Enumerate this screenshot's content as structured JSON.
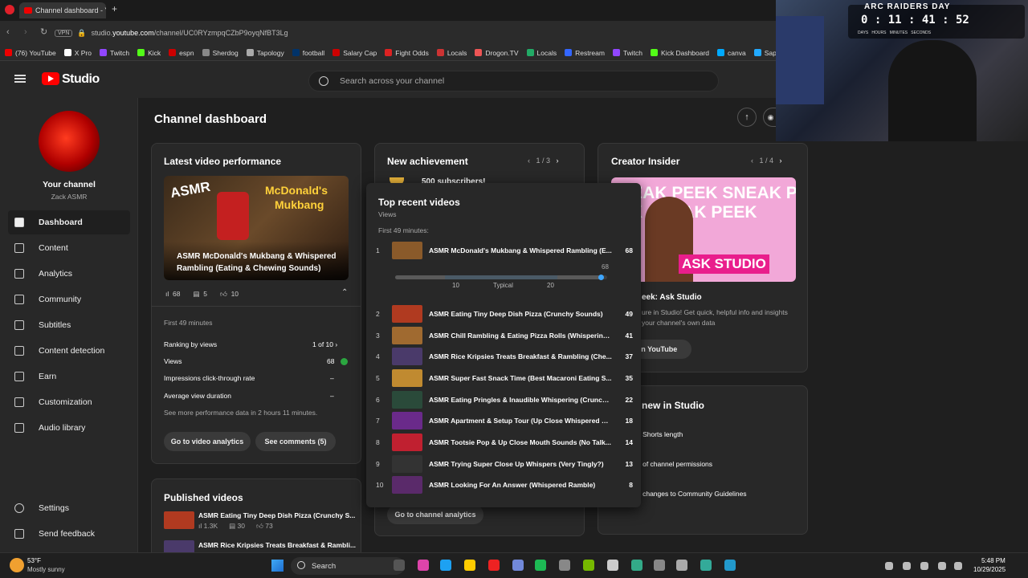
{
  "browser": {
    "tab_title": "Channel dashboard - You",
    "url_prefix": "studio.",
    "url_domain": "youtube.com",
    "url_path": "/channel/UC0RYzmpqCZbP9oyqNfBT3Lg",
    "vpn_label": "VPN",
    "bookmarks": [
      "(76) YouTube",
      "X Pro",
      "Twitch",
      "Kick",
      "espn",
      "Sherdog",
      "Tapology",
      "football",
      "Salary Cap",
      "Fight Odds",
      "Locals",
      "Drogon.TV",
      "Locals",
      "Restream",
      "Twitch",
      "Kick Dashboard",
      "canva",
      "Sapphire | Dashboard"
    ]
  },
  "header": {
    "logo_text": "Studio",
    "search_placeholder": "Search across your channel"
  },
  "sidebar": {
    "channel_label": "Your channel",
    "channel_name": "Zack ASMR",
    "items": [
      {
        "label": "Dashboard",
        "icon": "dashboard-icon"
      },
      {
        "label": "Content",
        "icon": "content-icon"
      },
      {
        "label": "Analytics",
        "icon": "analytics-icon"
      },
      {
        "label": "Community",
        "icon": "community-icon"
      },
      {
        "label": "Subtitles",
        "icon": "subtitles-icon"
      },
      {
        "label": "Content detection",
        "icon": "copyright-icon"
      },
      {
        "label": "Earn",
        "icon": "dollar-icon"
      },
      {
        "label": "Customization",
        "icon": "customization-icon"
      },
      {
        "label": "Audio library",
        "icon": "audio-library-icon"
      }
    ],
    "settings": "Settings",
    "feedback": "Send feedback"
  },
  "page_title": "Channel dashboard",
  "latest": {
    "title": "Latest video performance",
    "thumb_line1": "ASMR",
    "thumb_line2": "McDonald's",
    "thumb_line3": "Mukbang",
    "video_title": "ASMR McDonald's Mukbang & Whispered Rambling (Eating & Chewing Sounds)",
    "views": "68",
    "comments": "5",
    "likes": "10",
    "first_minutes": "First 49 minutes",
    "ranking_label": "Ranking by views",
    "ranking_value": "1 of 10",
    "views_label": "Views",
    "views_value": "68",
    "ctr_label": "Impressions click-through rate",
    "ctr_value": "–",
    "avd_label": "Average view duration",
    "avd_value": "–",
    "more_note": "See more performance data in 2 hours 11 minutes.",
    "btn_analytics": "Go to video analytics",
    "btn_comments": "See comments (5)"
  },
  "achievement": {
    "title": "New achievement",
    "pager": "1 / 3",
    "text": "500 subscribers!",
    "btn": "Go to channel analytics"
  },
  "insider": {
    "title": "Creator Insider",
    "pager": "1 / 4",
    "thumb_top": "SNEAK PEEK SNEAK PEEK SNEAK PEEK",
    "thumb_badge": "ASK STUDIO",
    "video_title": "eek: Ask Studio",
    "desc": "ure in Studio! Get quick, helpful info and insights your channel's own data",
    "btn": "on YouTube"
  },
  "whats_new": {
    "title": "new in Studio",
    "items": [
      "g Shorts length",
      "n of channel permissions",
      "g changes to Community Guidelines"
    ]
  },
  "published": {
    "title": "Published videos",
    "items": [
      {
        "title": "ASMR Eating Tiny Deep Dish Pizza (Crunchy S...",
        "views": "1.3K",
        "comments": "30",
        "likes": "73"
      },
      {
        "title": "ASMR Rice Kripsies Treats Breakfast & Rambli..."
      }
    ]
  },
  "popup": {
    "title": "Top recent videos",
    "subtitle": "Views",
    "range": "First 49 minutes:",
    "bar_value": "68",
    "bar_low": "10",
    "bar_mid": "Typical",
    "bar_high": "20",
    "bar_fill": 0.97,
    "videos": [
      {
        "rank": "1",
        "title": "ASMR McDonald's Mukbang & Whispered Rambling (E...",
        "views": "68",
        "thumb": "#8a5a2a"
      },
      {
        "rank": "2",
        "title": "ASMR Eating Tiny Deep Dish Pizza (Crunchy Sounds)",
        "views": "49",
        "thumb": "#b03a20"
      },
      {
        "rank": "3",
        "title": "ASMR Chill Rambling & Eating Pizza Rolls (Whispering ...",
        "views": "41",
        "thumb": "#a06a30"
      },
      {
        "rank": "4",
        "title": "ASMR Rice Kripsies Treats Breakfast & Rambling (Che...",
        "views": "37",
        "thumb": "#4a3a6a"
      },
      {
        "rank": "5",
        "title": "ASMR Super Fast Snack Time (Best Macaroni Eating S...",
        "views": "35",
        "thumb": "#c08a30"
      },
      {
        "rank": "6",
        "title": "ASMR Eating Pringles & Inaudible Whispering (Crunch...",
        "views": "22",
        "thumb": "#2a4a3a"
      },
      {
        "rank": "7",
        "title": "ASMR Apartment & Setup Tour (Up Close Whispered R...",
        "views": "18",
        "thumb": "#6a2a8a"
      },
      {
        "rank": "8",
        "title": "ASMR Tootsie Pop & Up Close Mouth Sounds (No Talk...",
        "views": "14",
        "thumb": "#c02030"
      },
      {
        "rank": "9",
        "title": "ASMR Trying Super Close Up Whispers (Very Tingly?)",
        "views": "13",
        "thumb": "#333333"
      },
      {
        "rank": "10",
        "title": "ASMR Looking For An Answer (Whispered Ramble)",
        "views": "8",
        "thumb": "#5a2a6a"
      }
    ]
  },
  "webcam": {
    "banner": "ARC RAIDERS DAY",
    "timer": "0 : 11 : 41 : 52",
    "units": "DAYS   HOURS   MINUTES   SECONDS"
  },
  "taskbar": {
    "temp": "53°F",
    "weather": "Mostly sunny",
    "search": "Search",
    "time": "5:48 PM",
    "date": "10/29/2025"
  }
}
